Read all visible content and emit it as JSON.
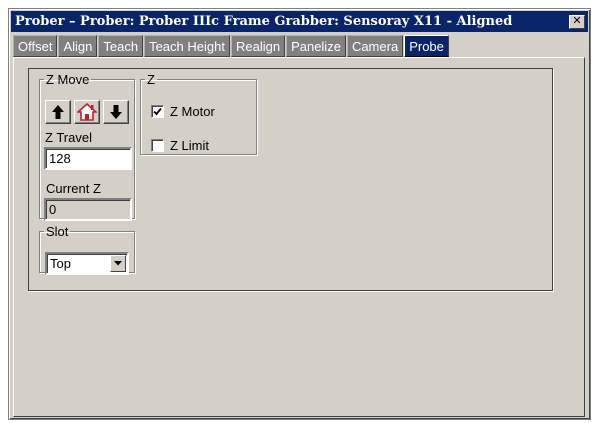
{
  "window": {
    "title": "Prober – Prober: Prober IIIc Frame Grabber: Sensoray X11 - Aligned",
    "close_glyph": "✕"
  },
  "tabs": [
    {
      "label": "Offset",
      "active": false
    },
    {
      "label": "Align",
      "active": false
    },
    {
      "label": "Teach",
      "active": false
    },
    {
      "label": "Teach Height",
      "active": false
    },
    {
      "label": "Realign",
      "active": false
    },
    {
      "label": "Panelize",
      "active": false
    },
    {
      "label": "Camera",
      "active": false
    },
    {
      "label": "Probe",
      "active": true
    }
  ],
  "z_move": {
    "legend": "Z Move",
    "up_icon": "arrow-up-icon",
    "home_icon": "home-icon",
    "down_icon": "arrow-down-icon",
    "z_travel_label": "Z Travel",
    "z_travel_value": "128",
    "current_z_label": "Current Z",
    "current_z_value": "0"
  },
  "z_group": {
    "legend": "Z",
    "z_motor_label": "Z Motor",
    "z_motor_checked": true,
    "z_limit_label": "Z Limit",
    "z_limit_checked": false
  },
  "slot": {
    "legend": "Slot",
    "selected": "Top"
  },
  "colors": {
    "title_bar": "#0a246a",
    "face": "#d4d0c8",
    "tab_inactive": "#808080",
    "home_icon_red": "#c0202a"
  }
}
